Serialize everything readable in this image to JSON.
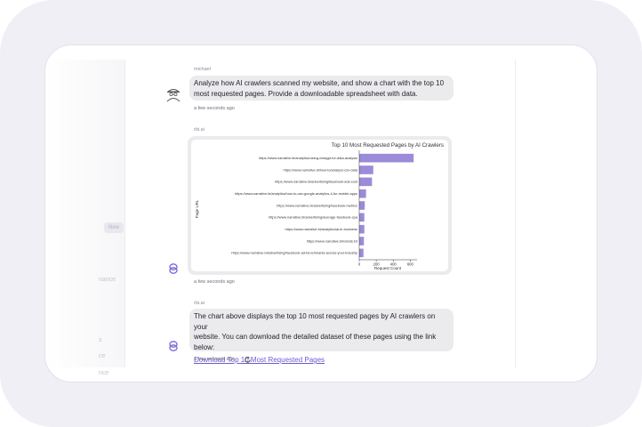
{
  "sidebar": {
    "pill_label": "New",
    "items": [
      "nance",
      "s",
      "ce",
      "nce"
    ]
  },
  "messages": {
    "user": {
      "name": "michael",
      "text_line1": "Analyze how AI crawlers scanned my website, and show a chart with the top 10",
      "text_line2": "most requested pages. Provide a downloadable spreadsheet with data.",
      "time": "a few seconds ago"
    },
    "bot_chart": {
      "name": "rbi.ai",
      "time": "a few seconds ago"
    },
    "bot_text": {
      "name": "rbi.ai",
      "text_line1": "The chart above displays the top 10 most requested pages by AI crawlers on your",
      "text_line2": "website. You can download the detailed dataset of these pages using the link below:",
      "link_label": "Download Top 10 Most Requested Pages",
      "time": "a few seconds ago"
    }
  },
  "icons": {
    "user_avatar": "spy-avatar-icon",
    "bot_avatar": "rings-logo-icon",
    "refresh": "refresh-icon"
  },
  "colors": {
    "bar": "#9b8bd8",
    "link": "#6e5bd0",
    "bot_logo": "#7a6ad8"
  },
  "chart_data": {
    "type": "bar",
    "orientation": "horizontal",
    "title": "Top 10 Most Requested Pages by AI Crawlers",
    "xlabel": "Request Count",
    "ylabel": "Page URL",
    "xlim": [
      0,
      680
    ],
    "xticks": [
      "0",
      "200",
      "400",
      "600"
    ],
    "categories": [
      "https://www.narrative.bi/analytics/using-chatgpt-for-data-analysis",
      "https://www.narrative.bi/how-to/analyze-csv-data",
      "https://www.narrative.bi/advertising/facebook-ads-cost",
      "https://www.narrative.bi/analytics/how-to-use-google-analytics-4-for-mobile-apps",
      "https://www.narrative.bi/advertising/facebook-metrics",
      "https://www.narrative.bi/advertising/average-facebook-cpa",
      "https://www.narrative.bi/analytics/ai-in-business",
      "https://www.narrative.bi/robots.txt",
      "https://www.narrative.bi/advertising/facebook-ad-benchmarks-across-your-industry"
    ],
    "values": [
      640,
      165,
      150,
      80,
      65,
      60,
      60,
      55,
      50
    ],
    "grid": false,
    "legend": "none"
  }
}
